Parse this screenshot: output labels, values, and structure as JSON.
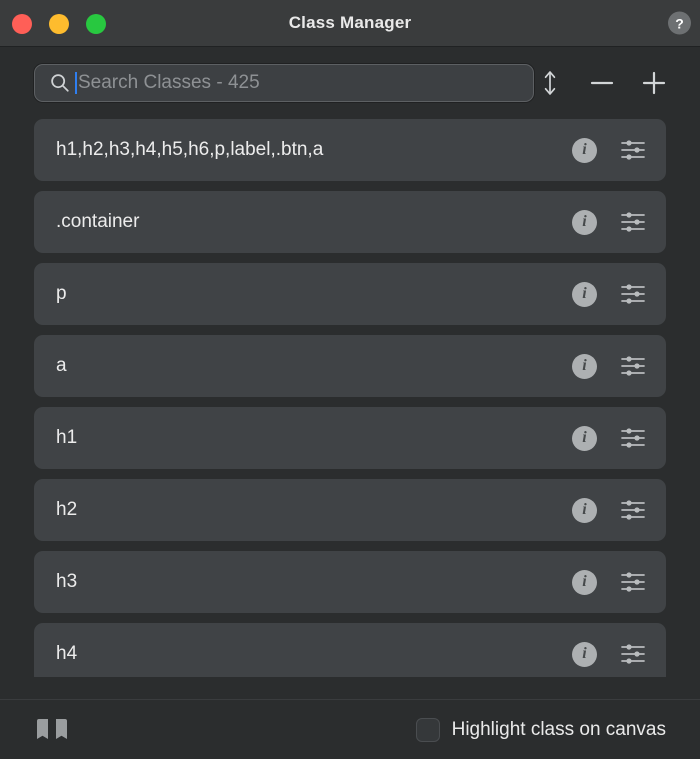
{
  "window": {
    "title": "Class Manager",
    "help_label": "?",
    "traffic_lights": [
      {
        "name": "close",
        "color": "#ff5f57"
      },
      {
        "name": "minimize",
        "color": "#febc2e"
      },
      {
        "name": "maximize",
        "color": "#28c840"
      }
    ]
  },
  "toolbar": {
    "search": {
      "placeholder": "Search Classes - 425",
      "value": "",
      "icon": "search-icon",
      "class_count": 425
    },
    "actions": [
      {
        "name": "sort-icon",
        "label": "Sort"
      },
      {
        "name": "minus-icon",
        "label": "Remove"
      },
      {
        "name": "plus-icon",
        "label": "Add"
      }
    ]
  },
  "list": {
    "rows": [
      {
        "name": "h1,h2,h3,h4,h5,h6,p,label,.btn,a"
      },
      {
        "name": ".container"
      },
      {
        "name": "p"
      },
      {
        "name": "a"
      },
      {
        "name": "h1"
      },
      {
        "name": "h2"
      },
      {
        "name": "h3"
      },
      {
        "name": "h4"
      }
    ],
    "row_actions": {
      "info_label": "i",
      "info_icon": "info-icon",
      "settings_icon": "sliders-icon"
    }
  },
  "footer": {
    "book_icon": "book-icon",
    "highlight_checkbox": {
      "label": "Highlight class on canvas",
      "checked": false
    }
  },
  "colors": {
    "window_background": "#2b2d2e",
    "titlebar_background": "#3a3c3d",
    "row_background": "#404346",
    "accent_caret": "#2f7ff1",
    "text_primary": "#ececec",
    "text_placeholder": "#8e9194"
  }
}
